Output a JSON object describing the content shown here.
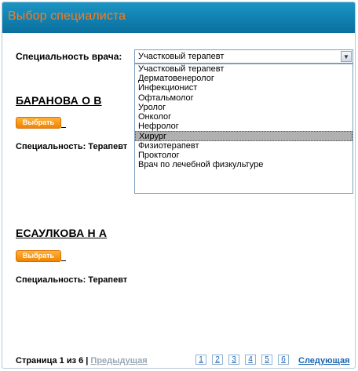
{
  "header": {
    "title": "Выбор специалиста"
  },
  "filter": {
    "label": "Специальность врача:",
    "selected": "Участковый терапевт",
    "options": [
      "Участковый терапевт",
      "Дерматовенеролог",
      "Инфекционист",
      "Офтальмолог",
      "Уролог",
      "Онколог",
      "Нефролог",
      "Хирург",
      "Физиотерапевт",
      "Проктолог",
      "Врач по лечебной физкультуре"
    ],
    "highlighted": "Хирург"
  },
  "doctors": [
    {
      "name": "БАРАНОВА О В",
      "button": "Выбрать",
      "specialty": "Специальность: Терапевт"
    },
    {
      "name": "ЕСАУЛКОВА Н А",
      "button": "Выбрать",
      "specialty": "Специальность: Терапевт"
    }
  ],
  "pager": {
    "text": "Страница 1 из 6 | ",
    "prev": "Предыдущая",
    "pages": [
      "1",
      "2",
      "3",
      "4",
      "5",
      "6"
    ],
    "next": "Следующая"
  },
  "colors": {
    "header_bg": "#0f7eae",
    "title": "#ff7a1a",
    "button": "#f08400",
    "link": "#1a64b2"
  }
}
